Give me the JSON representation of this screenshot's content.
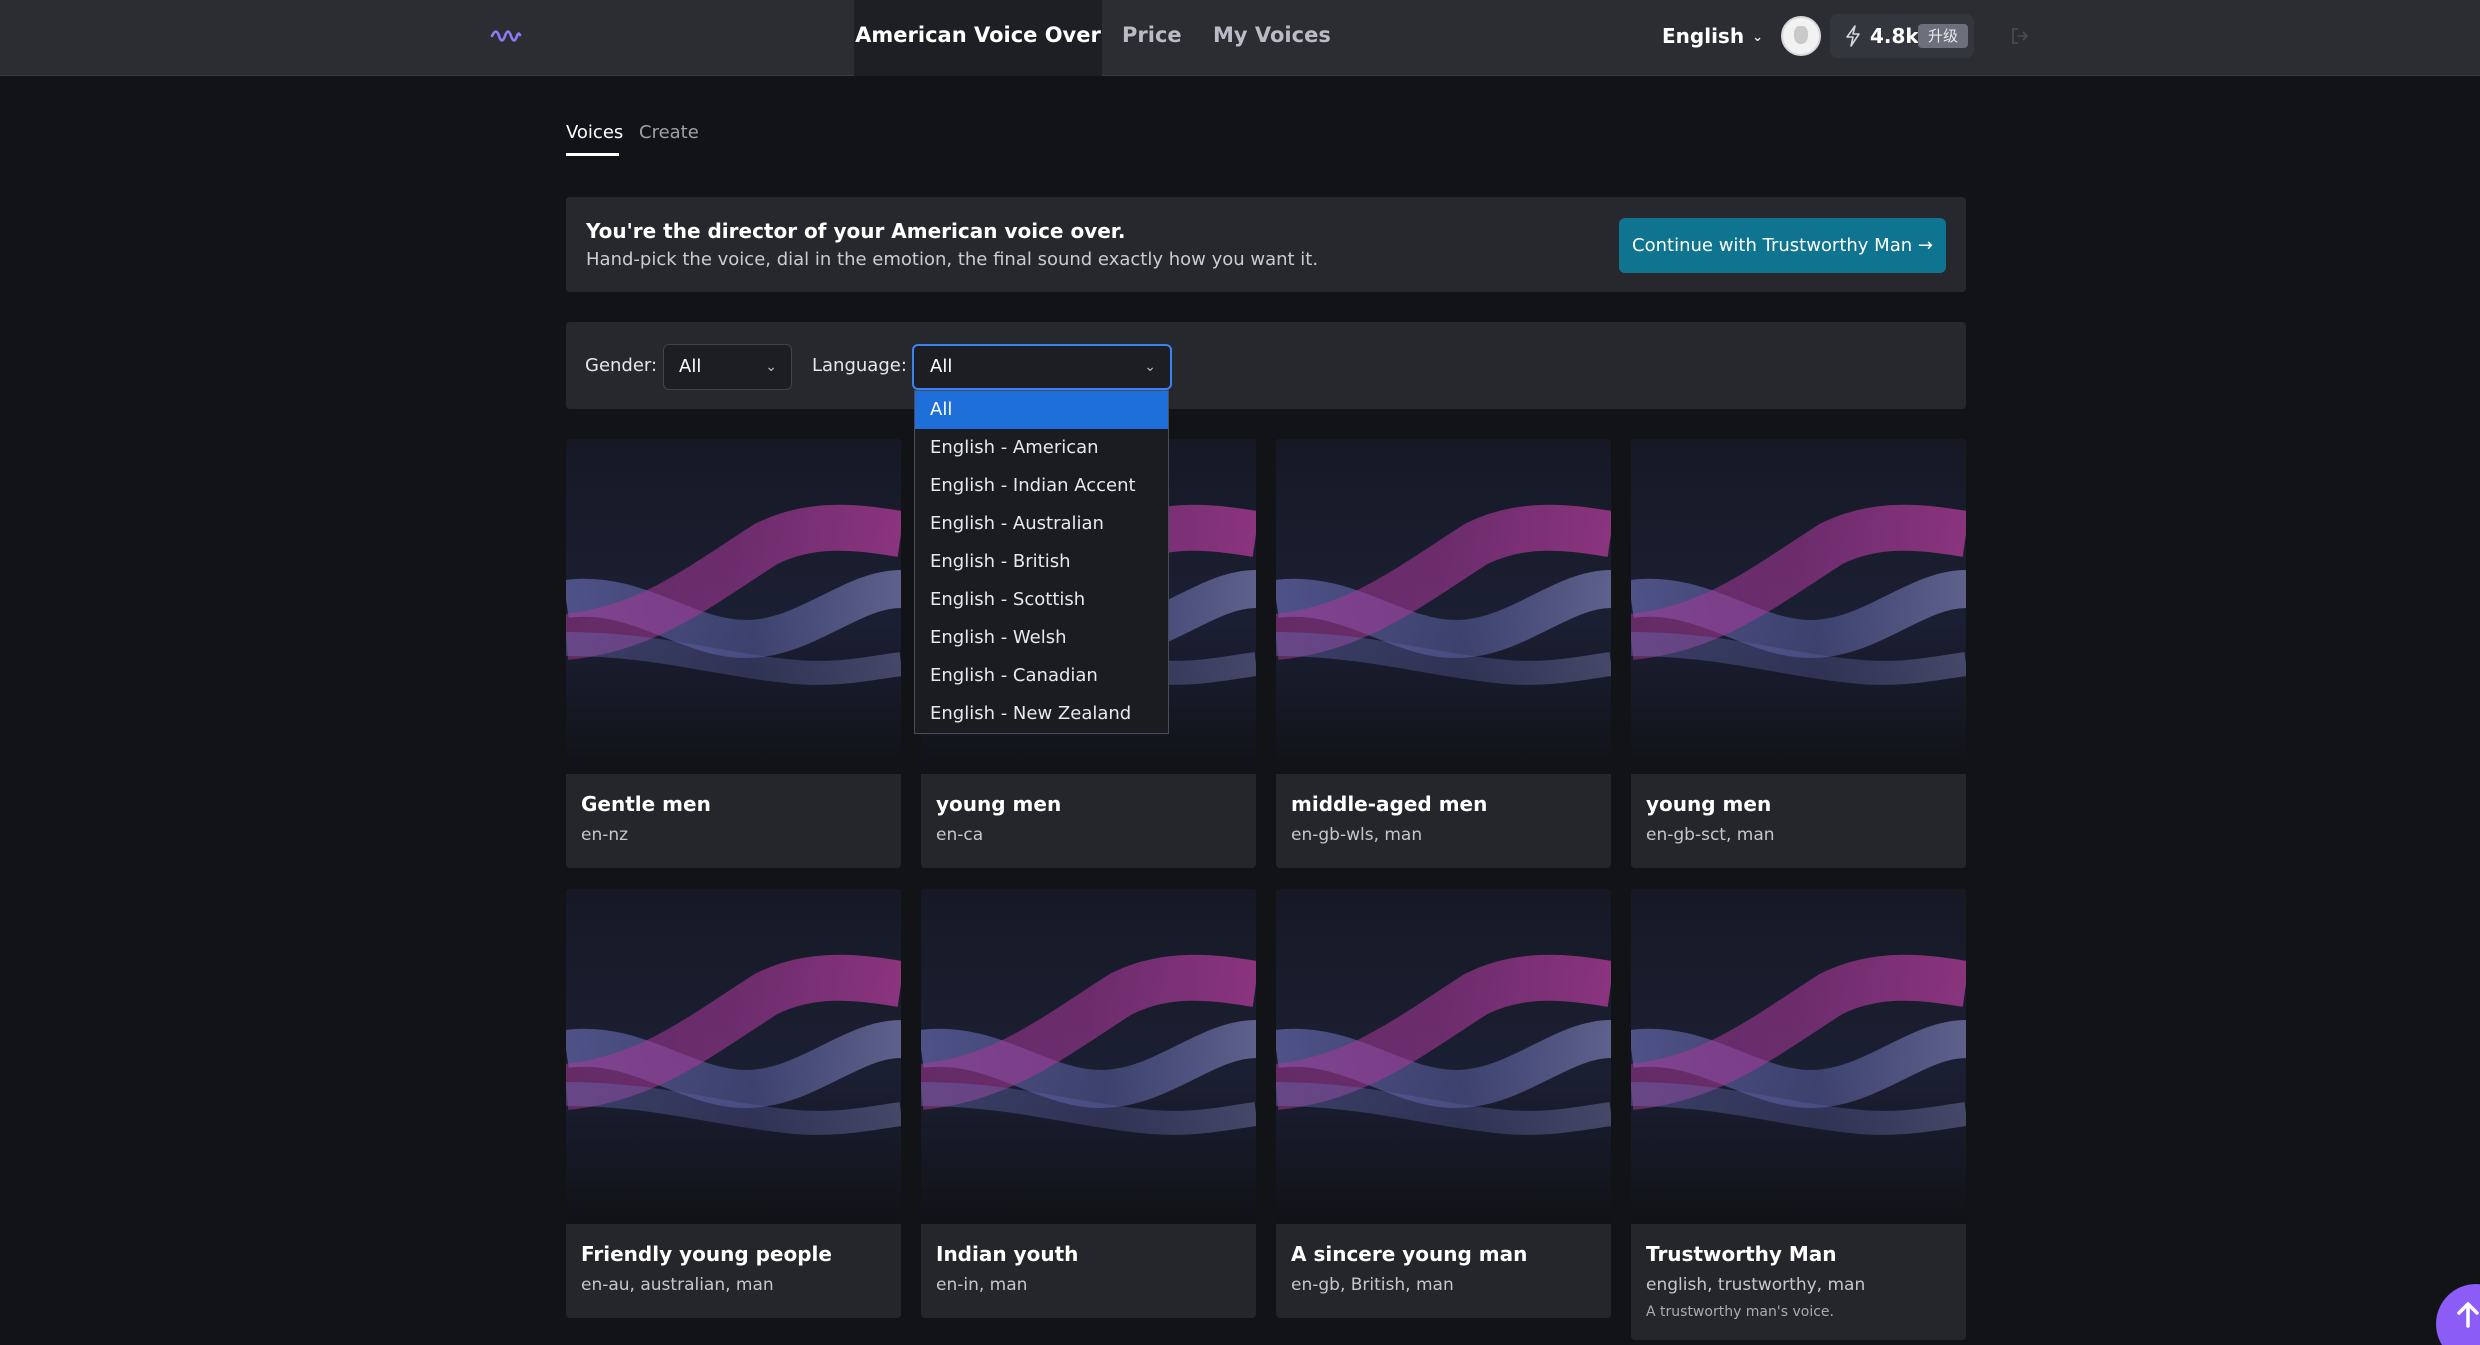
{
  "nav": {
    "logo_icon": "waveform-logo-icon",
    "items": [
      {
        "label": "American Voice Over",
        "active": true
      },
      {
        "label": "Price",
        "active": false
      },
      {
        "label": "My Voices",
        "active": false
      }
    ],
    "language": "English",
    "credits": "4.8k",
    "upgrade": "升级"
  },
  "tabs": [
    {
      "label": "Voices",
      "active": true
    },
    {
      "label": "Create",
      "active": false
    }
  ],
  "banner": {
    "title": "You're the director of your American voice over.",
    "subtitle": "Hand-pick the voice, dial in the emotion, the final sound exactly how you want it.",
    "cta": "Continue with Trustworthy Man →"
  },
  "filters": {
    "gender_label": "Gender:",
    "gender_value": "All",
    "language_label": "Language:",
    "language_value": "All",
    "language_options": [
      "All",
      "English - American",
      "English - Indian Accent",
      "English - Australian",
      "English - British",
      "English - Scottish",
      "English - Welsh",
      "English - Canadian",
      "English - New Zealand"
    ],
    "language_selected_option": "All"
  },
  "voices": [
    {
      "name": "Gentle men",
      "tags": "en-nz",
      "description": ""
    },
    {
      "name": "young men",
      "tags": "en-ca",
      "description": ""
    },
    {
      "name": "middle-aged men",
      "tags": "en-gb-wls, man",
      "description": ""
    },
    {
      "name": "young men",
      "tags": "en-gb-sct, man",
      "description": ""
    },
    {
      "name": "Friendly young people",
      "tags": "en-au, australian, man",
      "description": ""
    },
    {
      "name": "Indian youth",
      "tags": "en-in, man",
      "description": ""
    },
    {
      "name": "A sincere young man",
      "tags": "en-gb, British, man",
      "description": ""
    },
    {
      "name": "Trustworthy Man",
      "tags": "english, trustworthy, man",
      "description": "A trustworthy man's voice."
    }
  ],
  "colors": {
    "background": "#121317",
    "topbar": "#2b2d33",
    "panel": "#26282e",
    "cta": "#0e7490",
    "dropdown_highlight": "#1e6fd9",
    "focus_ring": "#3b82f6",
    "fab": "#8b5cf6"
  }
}
